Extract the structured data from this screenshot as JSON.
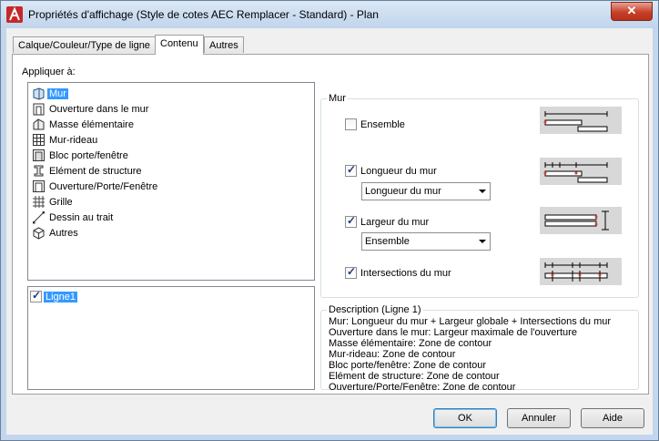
{
  "window": {
    "title": "Propriétés d'affichage (Style de cotes AEC Remplacer - Standard) - Plan",
    "close_glyph": "✕"
  },
  "tabs": [
    {
      "label": "Calque/Couleur/Type de ligne"
    },
    {
      "label": "Contenu",
      "active": true
    },
    {
      "label": "Autres"
    }
  ],
  "apply_to": {
    "label": "Appliquer à:",
    "items": [
      {
        "label": "Mur",
        "icon": "wall-icon",
        "selected": true
      },
      {
        "label": "Ouverture dans le mur",
        "icon": "wall-opening-icon"
      },
      {
        "label": "Masse élémentaire",
        "icon": "mass-element-icon"
      },
      {
        "label": "Mur-rideau",
        "icon": "curtain-wall-icon"
      },
      {
        "label": "Bloc porte/fenêtre",
        "icon": "door-window-block-icon"
      },
      {
        "label": "Elément de structure",
        "icon": "structural-member-icon"
      },
      {
        "label": "Ouverture/Porte/Fenêtre",
        "icon": "opening-door-window-icon"
      },
      {
        "label": "Grille",
        "icon": "grid-icon"
      },
      {
        "label": "Dessin au trait",
        "icon": "linework-icon"
      },
      {
        "label": "Autres",
        "icon": "others-icon"
      }
    ]
  },
  "lines": {
    "items": [
      {
        "label": "Ligne1",
        "checked": true,
        "selected": true
      }
    ]
  },
  "mur": {
    "title": "Mur",
    "ensemble": {
      "label": "Ensemble",
      "checked": false
    },
    "longueur": {
      "label": "Longueur du mur",
      "checked": true,
      "select_value": "Longueur du mur"
    },
    "largeur": {
      "label": "Largeur du mur",
      "checked": true,
      "select_value": "Ensemble"
    },
    "intersections": {
      "label": "Intersections du mur",
      "checked": true
    }
  },
  "description": {
    "title": "Description (Ligne 1)",
    "lines": [
      "Mur: Longueur du mur + Largeur globale + Intersections du mur",
      "Ouverture dans le mur: Largeur maximale de l'ouverture",
      "Masse élémentaire: Zone de contour",
      "Mur-rideau: Zone de contour",
      "Bloc porte/fenêtre: Zone de contour",
      "Elément de structure: Zone de contour",
      "Ouverture/Porte/Fenêtre: Zone de contour"
    ]
  },
  "buttons": {
    "ok": "OK",
    "cancel": "Annuler",
    "help": "Aide"
  },
  "colors": {
    "selection": "#3399ff",
    "close_button": "#c7402a",
    "accent_red": "#e03c31"
  }
}
